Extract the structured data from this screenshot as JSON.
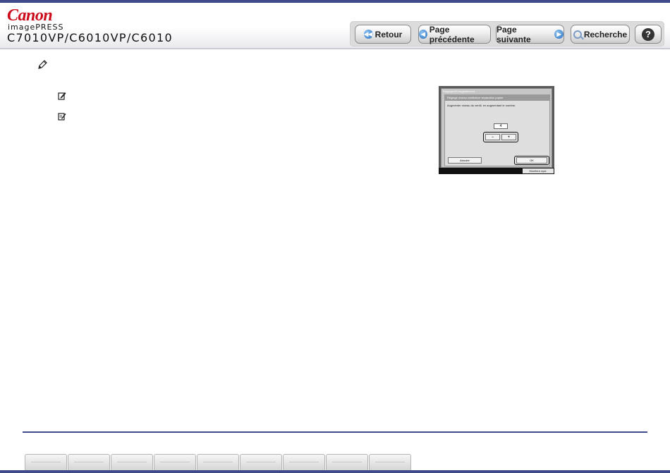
{
  "header": {
    "brand": "Canon",
    "series": "imagePRESS",
    "model": "C7010VP/C6010VP/C6010",
    "nav": {
      "back": "Retour",
      "prev": "Page précédente",
      "next": "Page suivante",
      "search": "Recherche",
      "help": "?"
    }
  },
  "device_screen": {
    "window_title": "Réglages/Enregistrement",
    "dialog_title": "Réglage niveau ventilateur séparation papier",
    "instruction": "Augmenter niveau du ventil. en augmentant le nombre.",
    "value": "4",
    "minus": "−",
    "plus": "+",
    "cancel": "Annuler",
    "ok": "OK",
    "monitor": "Moniteur syst."
  },
  "footer": {
    "tab_count": 9
  }
}
